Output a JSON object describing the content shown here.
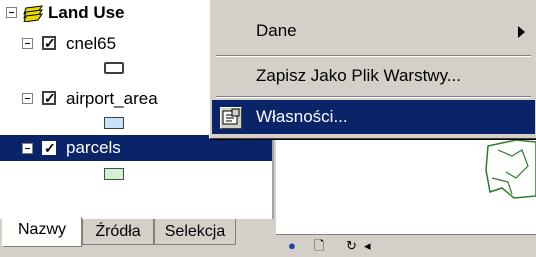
{
  "toc": {
    "group_label": "Land Use",
    "layers": [
      {
        "label": "cnel65",
        "checked": true,
        "swatch_fill": "#ffffff",
        "swatch_border": "#404040"
      },
      {
        "label": "airport_area",
        "checked": true,
        "swatch_fill": "#c6e2f7",
        "swatch_border": "#404040"
      },
      {
        "label": "parcels",
        "checked": true,
        "swatch_fill": "#d4f2d0",
        "swatch_border": "#4a4a4a",
        "selected": true
      }
    ]
  },
  "tabs": [
    {
      "label": "Nazwy",
      "active": true
    },
    {
      "label": "Źródła",
      "active": false
    },
    {
      "label": "Selekcja",
      "active": false
    }
  ],
  "context_menu": {
    "items": [
      {
        "label": "Dane",
        "has_submenu": true
      },
      {
        "label": "Zapisz Jako Plik Warstwy...",
        "has_submenu": false
      },
      {
        "label": "Własności...",
        "highlighted": true,
        "icon": "properties-icon"
      }
    ]
  },
  "colors": {
    "selection": "#0a246a",
    "panel": "#d4d0c8",
    "layer_icon": "#e8d800"
  }
}
